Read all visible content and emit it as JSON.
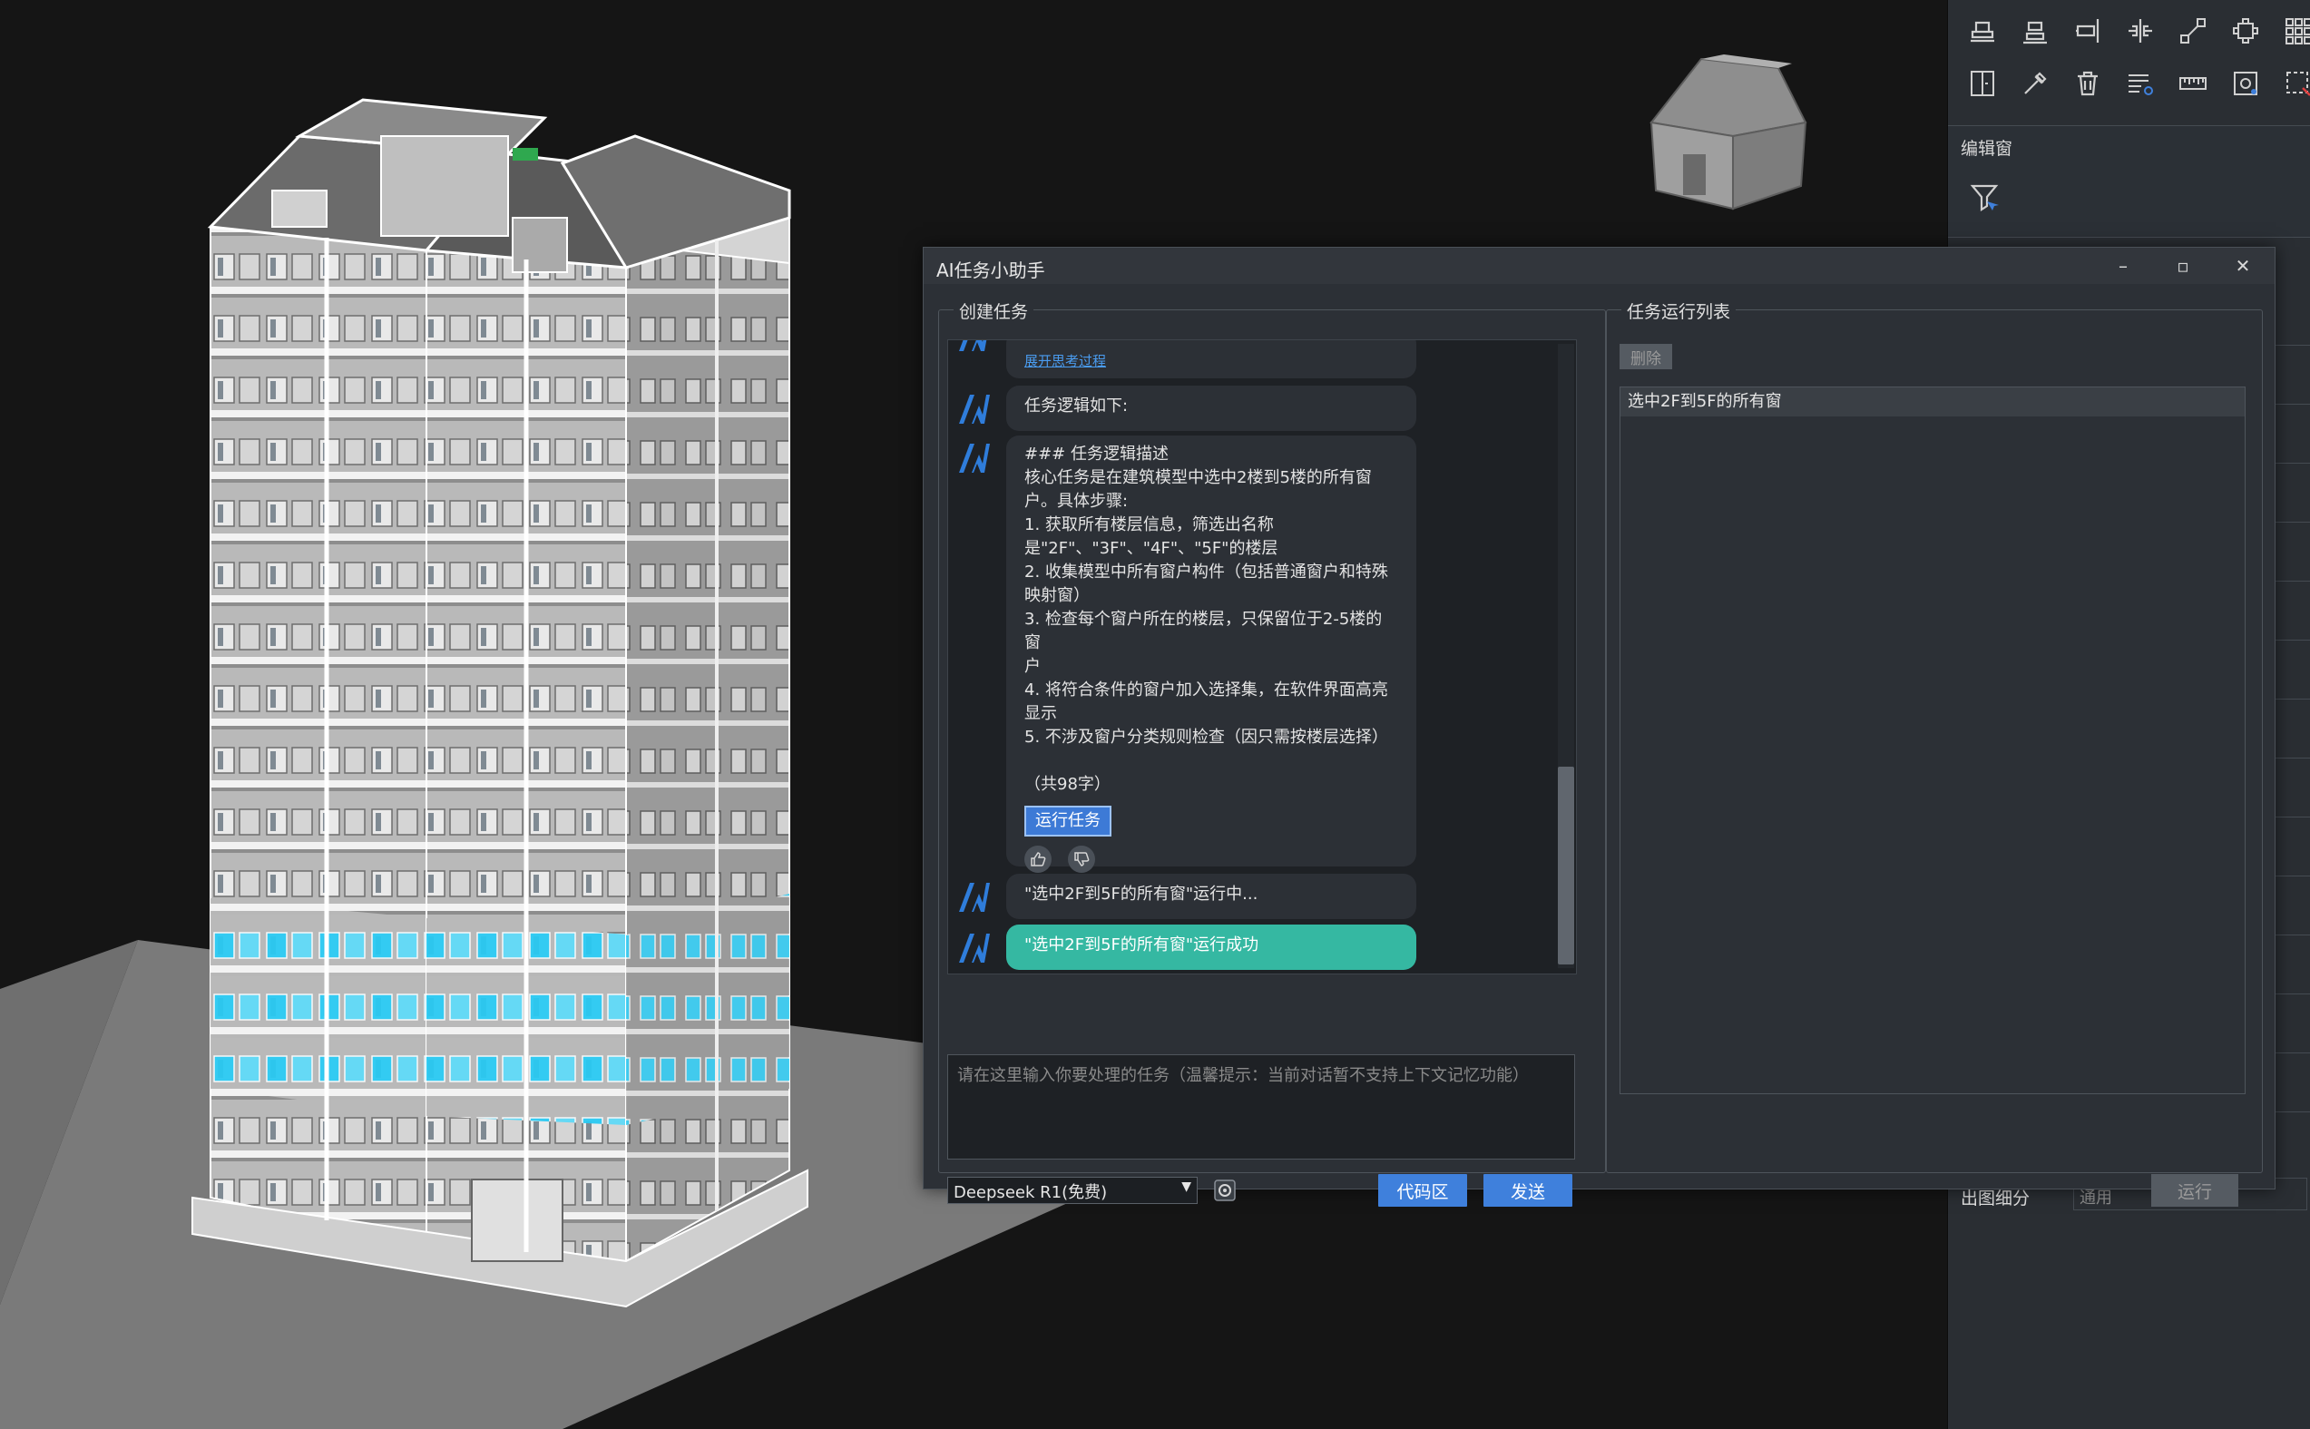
{
  "ai_dialog": {
    "title": "AI任务小助手",
    "window_controls": {
      "minimize": "–",
      "maximize": "▫",
      "close": "✕"
    },
    "create_task_group": {
      "label": "创建任务",
      "messages": {
        "show_thinking_link": "展开思考过程",
        "logic_header": "任务逻辑如下:",
        "logic_detail": [
          "### 任务逻辑描述",
          "核心任务是在建筑模型中选中2楼到5楼的所有窗",
          "户。具体步骤:",
          "1. 获取所有楼层信息，筛选出名称",
          "是\"2F\"、\"3F\"、\"4F\"、\"5F\"的楼层",
          "2. 收集模型中所有窗户构件（包括普通窗户和特殊",
          "映射窗）",
          "3. 检查每个窗户所在的楼层，只保留位于2-5楼的窗",
          "户",
          "4. 将符合条件的窗户加入选择集，在软件界面高亮",
          "显示",
          "5. 不涉及窗户分类规则检查（因只需按楼层选择）"
        ],
        "char_count": "（共98字）",
        "run_task_button": "运行任务",
        "running_status": "\"选中2F到5F的所有窗\"运行中...",
        "success_status": "\"选中2F到5F的所有窗\"运行成功"
      },
      "input_placeholder": "请在这里输入你要处理的任务（温馨提示：当前对话暂不支持上下文记忆功能）",
      "model_selected": "Deepseek R1(免费)",
      "code_area_button": "代码区",
      "send_button": "发送"
    },
    "task_list_group": {
      "label": "任务运行列表",
      "delete_button": "删除",
      "tasks": [
        "选中2F到5F的所有窗"
      ],
      "run_button": "运行"
    }
  },
  "right_panel": {
    "edit_window_title": "编辑窗",
    "output_detail_label": "出图细分",
    "output_detail_value": "通用"
  },
  "colors": {
    "accent_blue": "#3f80dc",
    "success_teal": "#35b8a2",
    "window_cyan": "#29c9f2",
    "panel_bg": "#2c3036"
  }
}
